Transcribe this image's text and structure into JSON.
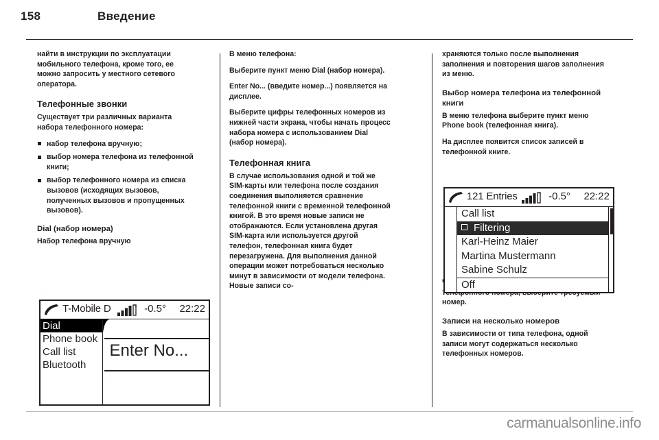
{
  "header": {
    "page_number": "158",
    "chapter": "Введение"
  },
  "columns": {
    "left": {
      "intro_paragraph": "найти в инструкции по эксплуатации мобильного телефона, кроме того, ее можно запросить у местного сетевого оператора.",
      "section_heading": "Телефонные звонки",
      "lead_in": "Существует три различных варианта набора телефонного номера:",
      "bullets": [
        "набор телефона вручную;",
        "выбор номера телефона из телефонной книги;",
        "выбор телефонного номера из списка вызовов (исходящих вызовов, полученных вызовов и пропущенных вызовов)."
      ],
      "sub_heading": "Dial (набор номера)",
      "sub_line": "Набор телефона вручную"
    },
    "middle": {
      "line_1": "В меню телефона:",
      "line_2": "Выберите пункт меню Dial (набор номера).",
      "line_3": "Enter No... (введите номер...) появляется на дисплее.",
      "line_4": "Выберите цифры телефонных номеров из нижней части экрана, чтобы начать процесс набора номера с использованием Dial (набор номера).",
      "section_heading": "Телефонная книга",
      "line_5": "В случае использования одной и той же SIM-карты или телефона после создания соединения выполняется сравнение телефонной книги с временной телефонной книгой. В это время новые записи не отображаются. Если установлена другая SIM-карта или используется другой телефон, телефонная книга будет перезагружена. Для выполнения данной операции может потребоваться несколько минут в зависимости от модели телефона. Новые записи со-"
    },
    "right": {
      "line_1": "храняются только после выполнения заполнения и повторения шагов заполнения из меню.",
      "section_heading": "Выбор номера телефона из телефонной книги",
      "line_2": "В меню телефона выберите пункт меню Phone book (телефонная книга).",
      "line_3": "На дисплее появится список записей в телефонной книге.",
      "line_4": "Чтобы инициировать процесс набора телефонного номера, выберите требуемый номер.",
      "section_heading_2": "Записи на несколько номеров",
      "line_5": "В зависимости от типа телефона, одной записи могут содержаться несколько телефонных номеров."
    }
  },
  "display_one": {
    "status": {
      "phone_icon": "phone-handset-icon",
      "operator": "T-Mobile D",
      "signal_icon": "signal-strength-icon",
      "temperature": "-0.5°",
      "clock": "22:22"
    },
    "menu_items": [
      {
        "label": "Dial",
        "selected": true
      },
      {
        "label": "Phone book",
        "selected": false
      },
      {
        "label": "Call list",
        "selected": false
      },
      {
        "label": "Bluetooth",
        "selected": false
      }
    ],
    "content_text": "Enter No..."
  },
  "display_two": {
    "status": {
      "phone_icon": "phone-handset-icon",
      "entries": "121 Entries",
      "signal_icon": "signal-strength-icon",
      "temperature": "-0.5°",
      "clock": "22:22"
    },
    "rows": [
      {
        "label": "Call list",
        "selected": false,
        "checkbox": false,
        "separator": false
      },
      {
        "label": "Filtering",
        "selected": true,
        "checkbox": true,
        "separator": false
      },
      {
        "label": "Karl-Heinz Maier",
        "selected": false,
        "checkbox": false,
        "separator": false
      },
      {
        "label": "Martina Mustermann",
        "selected": false,
        "checkbox": false,
        "separator": false
      },
      {
        "label": "Sabine Schulz",
        "selected": false,
        "checkbox": false,
        "separator": false
      },
      {
        "label": "Off",
        "selected": false,
        "checkbox": false,
        "separator": true
      }
    ]
  },
  "footer": {
    "brand": "carmanualsonline.info"
  },
  "colors": {
    "ink": "#231f20",
    "footer_gray": "#8d8d8d",
    "selection": "#000000"
  }
}
